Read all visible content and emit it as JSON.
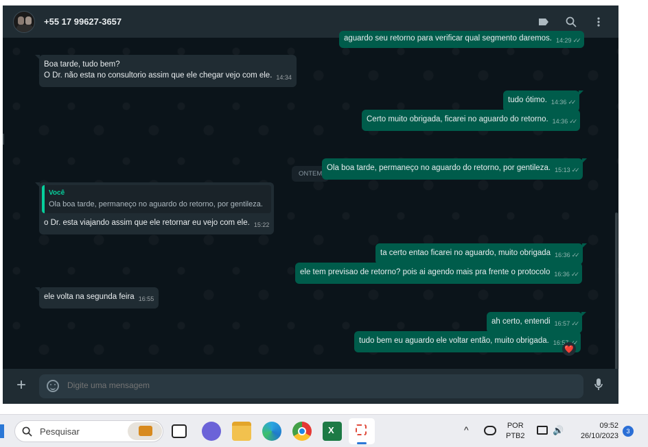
{
  "header": {
    "contact_name": "+55 17 99627-3657",
    "icons": [
      "label-icon",
      "search-icon",
      "menu-icon"
    ]
  },
  "messages": [
    {
      "id": "m0",
      "direction": "out",
      "text": "aguardo seu retorno para verificar qual segmento daremos.",
      "time": "14:29",
      "status": "read"
    },
    {
      "id": "m1",
      "direction": "in",
      "lines": [
        "Boa tarde, tudo bem?",
        "O Dr. não esta no consultorio assim que ele chegar vejo com ele."
      ],
      "time": "14:34"
    },
    {
      "id": "m2",
      "direction": "out",
      "text": "tudo ótimo.",
      "time": "14:36",
      "status": "read"
    },
    {
      "id": "m3",
      "direction": "out",
      "text": "Certo muito obrigada, ficarei no aguardo do retorno.",
      "time": "14:36",
      "status": "read"
    },
    {
      "id": "m4",
      "direction": "out",
      "text": "Ola boa tarde, permaneço no aguardo do retorno, por gentileza.",
      "time": "15:13",
      "status": "read"
    },
    {
      "id": "m5",
      "direction": "in",
      "quote_author": "Você",
      "quote_text": "Ola boa tarde, permaneço no aguardo do retorno, por gentileza.",
      "text": "o Dr. esta viajando assim que ele retornar eu vejo com ele.",
      "time": "15:22"
    },
    {
      "id": "m6",
      "direction": "out",
      "text": "ta certo entao ficarei no aguardo, muito obrigada",
      "time": "16:36",
      "status": "read"
    },
    {
      "id": "m7",
      "direction": "out",
      "text": "ele tem previsao de retorno? pois ai agendo mais pra frente o protocolo",
      "time": "16:36",
      "status": "read"
    },
    {
      "id": "m8",
      "direction": "in",
      "text": "ele volta na segunda feira",
      "time": "16:55"
    },
    {
      "id": "m9",
      "direction": "out",
      "text": "ah certo, entendi",
      "time": "16:57",
      "status": "read"
    },
    {
      "id": "m10",
      "direction": "out",
      "text": "tudo bem eu aguardo ele voltar então, muito obrigada.",
      "time": "16:57",
      "status": "read",
      "reaction": "❤️"
    }
  ],
  "day_separator": "ONTEM",
  "tick_glyph": "✓✓",
  "composer": {
    "placeholder": "Digite uma mensagem",
    "icons": [
      "plus-icon",
      "emoji-icon",
      "microphone-icon"
    ]
  },
  "taskbar": {
    "search_placeholder": "Pesquisar",
    "apps": [
      "task-view-icon",
      "meet-icon",
      "file-explorer-icon",
      "edge-icon",
      "chrome-icon",
      "excel-icon",
      "snipping-tool-icon"
    ],
    "language": "POR",
    "keyboard": "PTB2",
    "time": "09:52",
    "date": "26/10/2023",
    "notification_count": "3"
  },
  "colors": {
    "outgoing_bubble": "#005c4b",
    "incoming_bubble": "#202c33",
    "chat_background": "#0b141a",
    "accent_green": "#06cf9c"
  }
}
